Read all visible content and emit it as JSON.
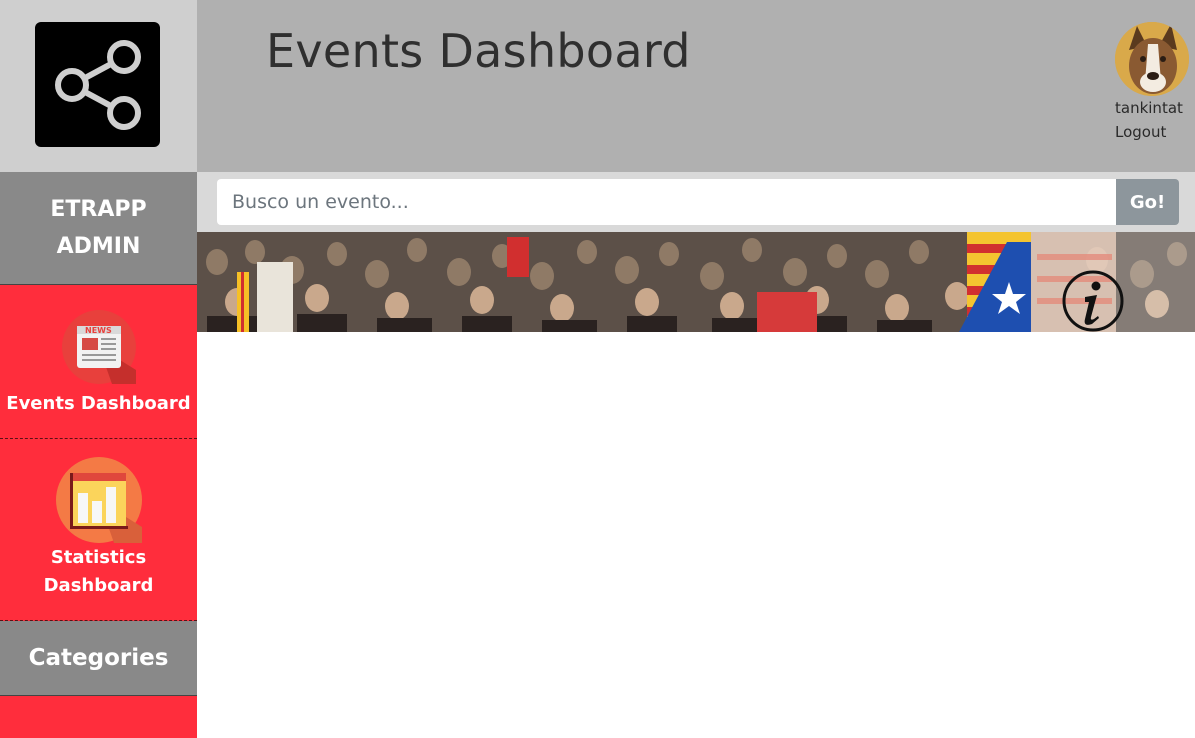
{
  "sidebar": {
    "logo_icon": "share-icon",
    "brand_line1": "ETRAPP",
    "brand_line2": "ADMIN",
    "items": [
      {
        "label": "Events Dashboard",
        "icon": "news-icon"
      },
      {
        "label_line1": "Statistics",
        "label_line2": "Dashboard",
        "icon": "statistics-icon"
      }
    ],
    "categories_label": "Categories"
  },
  "header": {
    "title": "Events Dashboard",
    "username": "tankintat",
    "logout_label": "Logout"
  },
  "search": {
    "placeholder": "Busco un evento...",
    "button_label": "Go!"
  },
  "banner": {
    "info_icon": "info-icon"
  },
  "colors": {
    "accent_red": "#ff2d3c",
    "sidebar_gray": "#898989",
    "header_gray": "#b0b0b0"
  }
}
